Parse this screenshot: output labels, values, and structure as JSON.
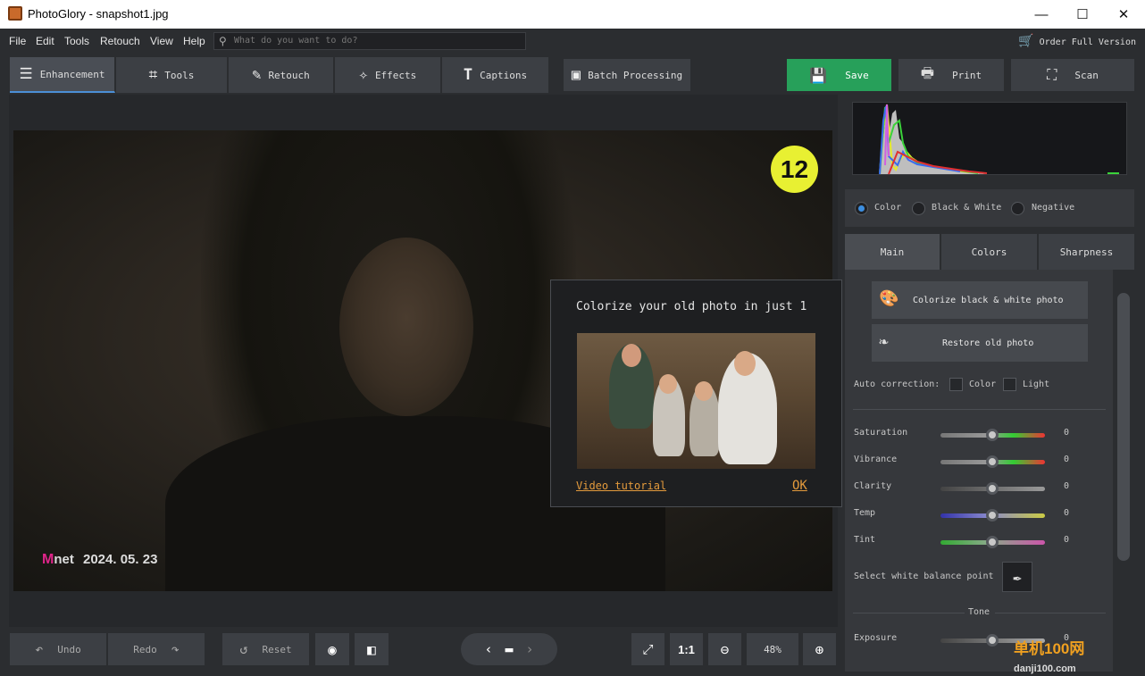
{
  "window": {
    "title": "PhotoGlory - snapshot1.jpg",
    "minimize": "—",
    "maximize": "☐",
    "close": "✕"
  },
  "menu": {
    "items": [
      "File",
      "Edit",
      "Tools",
      "Retouch",
      "View",
      "Help"
    ]
  },
  "search": {
    "placeholder": "What do you want to do?"
  },
  "order": {
    "label": "Order Full Version"
  },
  "tabs": [
    {
      "label": "Enhancement",
      "icon": "sliders-icon"
    },
    {
      "label": "Tools",
      "icon": "crop-icon"
    },
    {
      "label": "Retouch",
      "icon": "brush-icon"
    },
    {
      "label": "Effects",
      "icon": "magic-wand-icon"
    },
    {
      "label": "Captions",
      "icon": "text-icon"
    }
  ],
  "batch": {
    "label": "Batch Processing"
  },
  "actions": {
    "save": "Save",
    "print": "Print",
    "scan": "Scan"
  },
  "photo": {
    "badge": "12",
    "logo": "net",
    "date": "2024. 05. 23"
  },
  "popup": {
    "title": "Colorize your old photo in just 1",
    "video_link": "Video tutorial",
    "ok": "OK"
  },
  "bottom": {
    "undo": "Undo",
    "redo": "Redo",
    "reset": "Reset",
    "one_to_one": "1:1",
    "zoom": "48%"
  },
  "mode": {
    "options": [
      "Color",
      "Black & White",
      "Negative"
    ],
    "selected": "Color"
  },
  "panel_tabs": [
    "Main",
    "Colors",
    "Sharpness"
  ],
  "main": {
    "colorize_btn": "Colorize black & white photo",
    "restore_btn": "Restore old photo",
    "auto_correction": "Auto correction:",
    "auto_color": "Color",
    "auto_light": "Light",
    "sliders": [
      {
        "label": "Saturation",
        "value": "0"
      },
      {
        "label": "Vibrance",
        "value": "0"
      },
      {
        "label": "Clarity",
        "value": "0"
      },
      {
        "label": "Temp",
        "value": "0"
      },
      {
        "label": "Tint",
        "value": "0"
      }
    ],
    "white_balance": "Select white balance point",
    "tone": "Tone",
    "exposure": {
      "label": "Exposure",
      "value": "0"
    }
  },
  "watermark": {
    "main": "单机100网",
    "sub": "danji100.com"
  }
}
